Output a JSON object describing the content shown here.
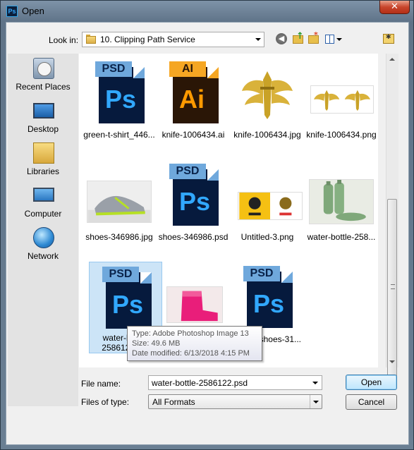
{
  "window": {
    "title": "Open",
    "app_icon_text": "Ps",
    "close_glyph": "✕"
  },
  "toolbar": {
    "look_in_label": "Look in:",
    "look_in_value": "10. Clipping Path Service",
    "back_glyph": "◀"
  },
  "places": [
    {
      "label": "Recent Places",
      "icon": "recent-places-icon"
    },
    {
      "label": "Desktop",
      "icon": "desktop-icon"
    },
    {
      "label": "Libraries",
      "icon": "libraries-icon"
    },
    {
      "label": "Computer",
      "icon": "computer-icon"
    },
    {
      "label": "Network",
      "icon": "network-icon"
    }
  ],
  "files": [
    {
      "name": "green-t-shirt_446...",
      "kind": "psd"
    },
    {
      "name": "knife-1006434.ai",
      "kind": "ai"
    },
    {
      "name": "knife-1006434.jpg",
      "kind": "image"
    },
    {
      "name": "knife-1006434.png",
      "kind": "image"
    },
    {
      "name": "shoes-346986.jpg",
      "kind": "image"
    },
    {
      "name": "shoes-346986.psd",
      "kind": "psd"
    },
    {
      "name": "Untitled-3.png",
      "kind": "image"
    },
    {
      "name": "water-bottle-258...",
      "kind": "image"
    },
    {
      "name": "water-bottle-2586122.psd",
      "kind": "psd",
      "selected": true
    },
    {
      "name": "",
      "kind": "image"
    },
    {
      "name": "shoes-31...",
      "kind": "psd"
    }
  ],
  "file_icon_labels": {
    "psd_tag": "PSD",
    "psd_big": "Ps",
    "ai_tag": "AI",
    "ai_big": "Ai"
  },
  "tooltip": {
    "type": "Type: Adobe Photoshop Image 13",
    "size": "Size: 49.6 MB",
    "date": "Date modified: 6/13/2018 4:15 PM"
  },
  "form": {
    "file_name_label": "File name:",
    "file_name_value": "water-bottle-2586122.psd",
    "files_of_type_label": "Files of type:",
    "files_of_type_value": "All Formats",
    "open_label": "Open",
    "cancel_label": "Cancel"
  },
  "colors": {
    "psd_bg": "#061a3d",
    "psd_accent": "#31a8ff",
    "ai_bg": "#2a1606",
    "ai_accent": "#ff9a00",
    "selection": "#cce4f7"
  }
}
